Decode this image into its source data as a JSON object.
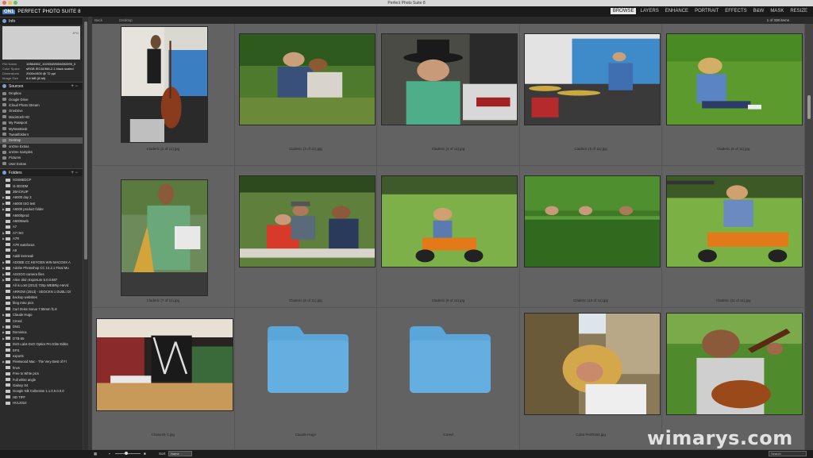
{
  "window": {
    "title": "Perfect Photo Suite 8"
  },
  "app": {
    "logo_mark": "ON1",
    "name": "PERFECT PHOTO SUITE 8"
  },
  "modules": [
    {
      "label": "BROWSE",
      "active": true
    },
    {
      "label": "LAYERS",
      "active": false
    },
    {
      "label": "ENHANCE",
      "active": false
    },
    {
      "label": "PORTRAIT",
      "active": false
    },
    {
      "label": "EFFECTS",
      "active": false
    },
    {
      "label": "B&W",
      "active": false
    },
    {
      "label": "MASK",
      "active": false
    },
    {
      "label": "RESIZE",
      "active": false
    }
  ],
  "info": {
    "title": "Info",
    "preview_badge": "JPG",
    "rows": [
      {
        "k": "File Name",
        "v": "10564352_10203489054692099_5"
      },
      {
        "k": "Color Space",
        "v": "sRGB IEC61966-2.1 black scaled"
      },
      {
        "k": "Dimensions",
        "v": "2000x1500 @ 72 ppi"
      },
      {
        "k": "Image Size",
        "v": "8.6 MB (8 bit)"
      }
    ]
  },
  "sources": {
    "title": "Sources",
    "items": [
      "Dropbox",
      "Google Drive",
      "iCloud Photo Stream",
      "OneDrive",
      "Macintosh HD",
      "My Passport",
      "MyNewBook",
      "Tweakfolder4",
      "Desktop",
      "onOne Extras",
      "onOne Samples",
      "Pictures",
      "User Extras"
    ],
    "selected_index": 8
  },
  "folders": {
    "title": "Folders",
    "items": [
      "!!DSMEDCP",
      "!4-3D3DM",
      "2BACKUP",
      "A6000 day 3",
      "A6000 ISO test",
      "A6000 product folder",
      "A6000prod",
      "A6000web",
      "A7",
      "A7 ISO",
      "A7R",
      "A7R autofocus",
      "A9",
      "Aaldi kenneali",
      "ADOBE CC KEYGEN WIN MACOSX A",
      "Adobe Photoshop CC 14.2.1 Final Mu",
      "AGOOO camera files",
      "Alien Skin Exposure 5.0.0.687",
      "All is Lost (2013) 720p WEBRip HeVd",
      "ARROW (2013) - SEOCKN 1 DUBLI Dr",
      "backup websites",
      "blog misc pics",
      "Carl Zeiss Sonar 7.55mm f1.8",
      "Claude Hugo",
      "Creed",
      "DNG",
      "Dominica",
      "DTB-55",
      "DxO Labs DxO Optics Pro Elite Editio",
      "EPS",
      "exports",
      "Fleetwood Mac - The Very Best of Fl",
      "fmvs",
      "Free to Whte pics",
      "Full white angle",
      "Galaxy S4",
      "Google Nik Collection 1.1.0.0.0.0.0",
      "HD TIFF",
      "HVL2010"
    ],
    "expanded_markers": [
      3,
      4,
      5,
      9,
      10,
      14,
      15,
      16,
      17,
      23,
      25,
      26,
      27,
      31
    ]
  },
  "pathbar": {
    "back": "Back",
    "path": "Desktop",
    "count": "1 of 338 items"
  },
  "thumbs": [
    {
      "caption": "Claderic (2 of 11).jpg",
      "kind": "photo",
      "scene": "bass"
    },
    {
      "caption": "Claderic (3 of 11).jpg",
      "kind": "photo",
      "scene": "crowd1"
    },
    {
      "caption": "Claderic (4 of 11).jpg",
      "kind": "photo",
      "scene": "hat"
    },
    {
      "caption": "Claderic (5 of 11).jpg",
      "kind": "photo",
      "scene": "drums"
    },
    {
      "caption": "Claderic (6 of 11).jpg",
      "kind": "photo",
      "scene": "boygrass"
    },
    {
      "caption": "Claderic (7 of 11).jpg",
      "kind": "photo",
      "scene": "sax"
    },
    {
      "caption": "Claderic (8 of 11).jpg",
      "kind": "photo",
      "scene": "table"
    },
    {
      "caption": "Claderic (9 of 11).jpg",
      "kind": "photo",
      "scene": "bike1"
    },
    {
      "caption": "Claderic (10 of 11).jpg",
      "kind": "photo",
      "scene": "hedge"
    },
    {
      "caption": "Claderic (11 of 11).jpg",
      "kind": "photo",
      "scene": "bike2"
    },
    {
      "caption": "Chase44-1.jpg",
      "kind": "photo",
      "scene": "interior"
    },
    {
      "caption": "Claude Hugo",
      "kind": "folder",
      "scene": ""
    },
    {
      "caption": "Creed",
      "kind": "folder",
      "scene": ""
    },
    {
      "caption": "Cuba PA00184.jpg",
      "kind": "photo",
      "scene": "woman"
    },
    {
      "caption": "",
      "kind": "photo",
      "scene": "guitar"
    }
  ],
  "colors": {
    "folder": "#5aa6d8",
    "grid_bg": "#626262",
    "active_module": "#e8e8e8"
  },
  "bottom": {
    "sort_label": "Sort",
    "sort_value": "Name",
    "search_placeholder": "Search"
  },
  "watermark": "wimarys.com"
}
